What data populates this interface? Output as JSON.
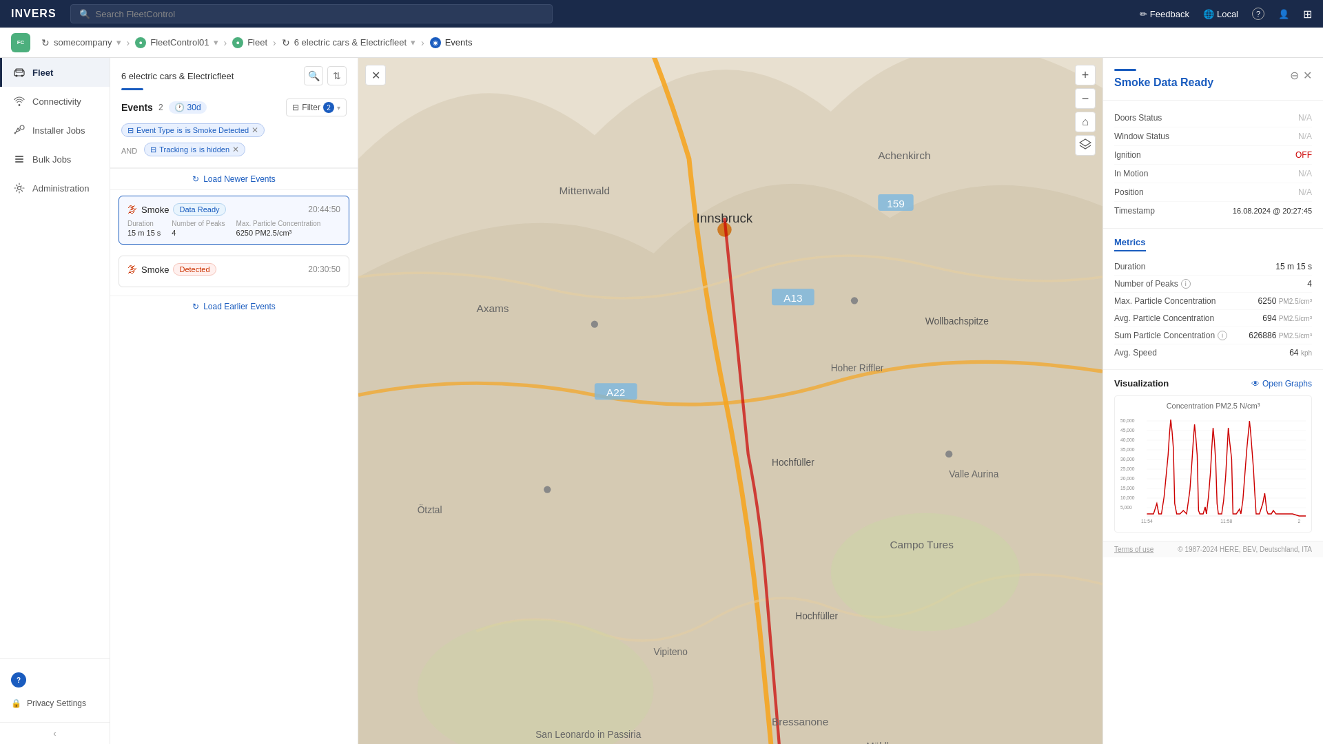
{
  "topNav": {
    "logo": "INVERS",
    "searchPlaceholder": "Search FleetControl",
    "feedback": "Feedback",
    "locale": "Local",
    "helpIcon": "?",
    "userIcon": "👤",
    "exitIcon": "⬚"
  },
  "breadcrumb": {
    "appIcon": "FC",
    "items": [
      {
        "label": "somecompany",
        "icon": "●"
      },
      {
        "label": "FleetControl01",
        "dropdown": true
      },
      {
        "sep": "›"
      },
      {
        "label": "Fleet",
        "icon": "●"
      },
      {
        "sep": "›"
      },
      {
        "label": "6 electric cars & Electricfleet",
        "dropdown": true
      },
      {
        "sep": "›"
      },
      {
        "label": "Events",
        "icon": "◉",
        "active": true
      }
    ]
  },
  "sidebar": {
    "items": [
      {
        "id": "fleet",
        "label": "Fleet",
        "icon": "🚗"
      },
      {
        "id": "connectivity",
        "label": "Connectivity",
        "icon": "📡"
      },
      {
        "id": "installer-jobs",
        "label": "Installer Jobs",
        "icon": "🔧"
      },
      {
        "id": "bulk-jobs",
        "label": "Bulk Jobs",
        "icon": "📋"
      },
      {
        "id": "administration",
        "label": "Administration",
        "icon": "⚙"
      }
    ],
    "footer": {
      "privacy": "Privacy Settings",
      "collapseIcon": "‹"
    }
  },
  "eventsPanel": {
    "deviceName": "6 electric cars & Electricfleet",
    "blueBar": true,
    "eventsLabel": "Events",
    "eventsCount": "2",
    "dateBadge": "30d",
    "filterLabel": "Filter",
    "filterCount": "2",
    "filterTags": {
      "andLabel": "AND",
      "tag1Type": "Event Type",
      "tag1Value": "is Smoke Detected",
      "tag2Type": "Tracking",
      "tag2Value": "is hidden"
    },
    "loadNewer": "Load Newer Events",
    "loadEarlier": "Load Earlier Events",
    "events": [
      {
        "id": 1,
        "name": "Smoke",
        "status": "Data Ready",
        "statusType": "data-ready",
        "time": "20:44:50",
        "duration": "15 m 15 s",
        "numPeaks": "4",
        "maxConc": "6250 PM2.5/cm³",
        "selected": true
      },
      {
        "id": 2,
        "name": "Smoke",
        "status": "Detected",
        "statusType": "detected",
        "time": "20:30:50",
        "selected": false
      }
    ]
  },
  "smokePanel": {
    "title": "Smoke Data Ready",
    "statusSection": {
      "doorsLabel": "Doors Status",
      "doorsValue": "N/A",
      "windowLabel": "Window Status",
      "windowValue": "N/A",
      "ignitionLabel": "Ignition",
      "ignitionValue": "OFF",
      "inMotionLabel": "In Motion",
      "inMotionValue": "N/A",
      "positionLabel": "Position",
      "positionValue": "N/A",
      "timestampLabel": "Timestamp",
      "timestampValue": "16.08.2024 @ 20:27:45"
    },
    "metricsSection": {
      "title": "Metrics",
      "rows": [
        {
          "label": "Duration",
          "value": "15 m 15 s",
          "unit": "",
          "info": false
        },
        {
          "label": "Number of Peaks",
          "value": "4",
          "unit": "",
          "info": true
        },
        {
          "label": "Max. Particle Concentration",
          "value": "6250",
          "unit": "PM2.5/cm³",
          "info": false
        },
        {
          "label": "Avg. Particle Concentration",
          "value": "694",
          "unit": "PM2.5/cm³",
          "info": false
        },
        {
          "label": "Sum Particle Concentration",
          "value": "626886",
          "unit": "PM2.5/cm³",
          "info": true
        },
        {
          "label": "Avg. Speed",
          "value": "64",
          "unit": "kph",
          "info": false
        }
      ]
    },
    "visualization": {
      "title": "Visualization",
      "openGraphs": "Open Graphs",
      "chartTitle": "Concentration PM2.5 N/cm³",
      "yAxisLabels": [
        "50,000",
        "45,000",
        "40,000",
        "35,000",
        "30,000",
        "25,000",
        "20,000",
        "15,000",
        "10,000",
        "5,000"
      ],
      "xAxisLabels": [
        "11:54",
        "11:58",
        "2"
      ],
      "chartColor": "#cc0000"
    },
    "terms": {
      "left": "Terms of use",
      "right": "© 1987-2024 HERE, BEV, Deutschland, ITA"
    }
  },
  "map": {
    "closeIcon": "✕",
    "zoomIn": "+",
    "zoomOut": "−",
    "homeIcon": "⌂",
    "layersIcon": "⊞"
  },
  "colors": {
    "navBg": "#1a2a4a",
    "accent": "#1a5cbf",
    "smokeRed": "#cc3300",
    "chartRed": "#cc0000"
  }
}
